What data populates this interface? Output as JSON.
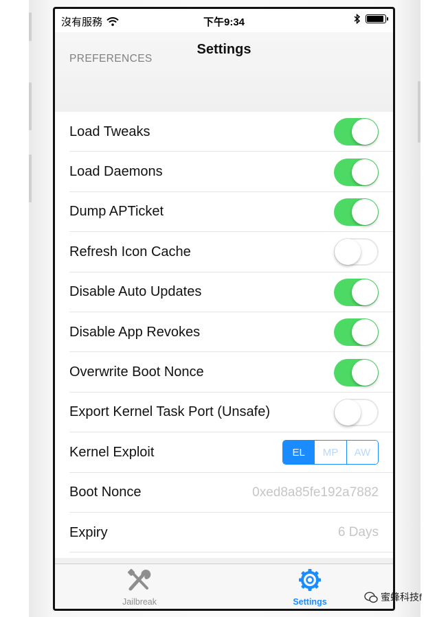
{
  "status_bar": {
    "carrier": "沒有服務",
    "time": "下午9:34",
    "battery_level": 0.85
  },
  "nav": {
    "section_header": "PREFERENCES",
    "title": "Settings"
  },
  "rows": [
    {
      "label": "Load Tweaks",
      "type": "switch",
      "on": true
    },
    {
      "label": "Load Daemons",
      "type": "switch",
      "on": true
    },
    {
      "label": "Dump APTicket",
      "type": "switch",
      "on": true
    },
    {
      "label": "Refresh Icon Cache",
      "type": "switch",
      "on": false
    },
    {
      "label": "Disable Auto Updates",
      "type": "switch",
      "on": true
    },
    {
      "label": "Disable App Revokes",
      "type": "switch",
      "on": true
    },
    {
      "label": "Overwrite Boot Nonce",
      "type": "switch",
      "on": true
    },
    {
      "label": "Export Kernel Task Port (Unsafe)",
      "type": "switch",
      "on": false
    },
    {
      "label": "Kernel Exploit",
      "type": "segmented",
      "options": [
        "EL",
        "MP",
        "AW"
      ],
      "selected": 0
    },
    {
      "label": "Boot Nonce",
      "type": "value",
      "value": "0xed8a85fe192a7882"
    },
    {
      "label": "Expiry",
      "type": "value",
      "value": "6 Days"
    }
  ],
  "tab_bar": {
    "jailbreak_label": "Jailbreak",
    "settings_label": "Settings",
    "active": "settings"
  },
  "watermark": {
    "text": "蜜蜂科技f"
  },
  "colors": {
    "switch_on": "#4cd964",
    "accent": "#1a8cff",
    "secondary_text": "#c6c6c6"
  }
}
